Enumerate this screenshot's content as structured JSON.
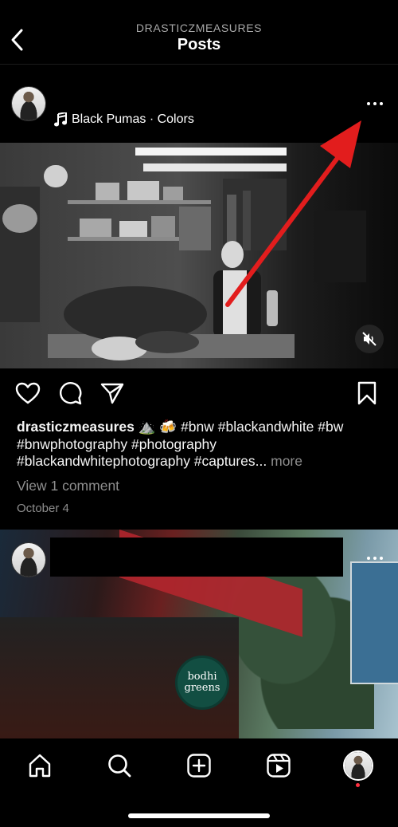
{
  "header": {
    "username": "DRASTICZMEASURES",
    "title": "Posts"
  },
  "post1": {
    "music": "Black Pumas · Colors",
    "caption_user": "drasticzmeasures",
    "caption_emojis": "⛰️ 🍻",
    "caption_text": "#bnw #blackandwhite #bw #bnwphotography #photography #blackandwhitephotography #captures...",
    "caption_more": "more",
    "view_comments": "View 1 comment",
    "date": "October 4",
    "mute_state": "muted"
  },
  "post2": {
    "sign_line1": "bodhi",
    "sign_line2": "greens"
  },
  "icons": {
    "back": "chevron-left-icon",
    "more": "more-horizontal-icon",
    "music": "music-note-icon",
    "mute": "speaker-muted-icon",
    "like": "heart-icon",
    "comment": "comment-icon",
    "share": "send-icon",
    "save": "bookmark-icon",
    "home": "home-icon",
    "search": "search-icon",
    "create": "plus-square-icon",
    "reels": "reels-icon",
    "profile": "profile-avatar"
  },
  "colors": {
    "background": "#000000",
    "secondary_text": "#8e8e8e",
    "annotation_arrow": "#e21d1d",
    "notification_dot": "#ff3040"
  }
}
